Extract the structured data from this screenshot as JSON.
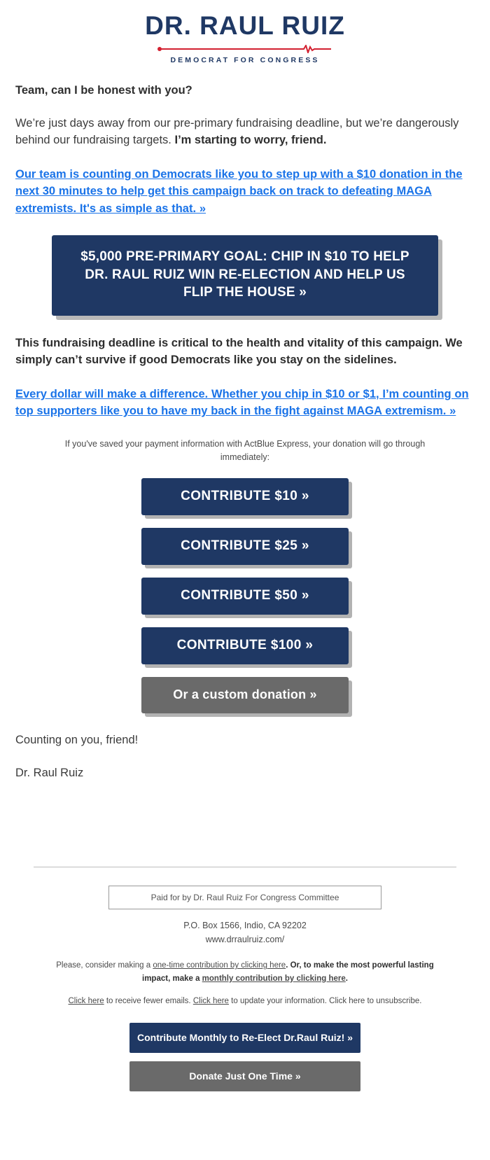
{
  "logo": {
    "name": "DR. RAUL RUIZ",
    "tagline": "DEMOCRAT FOR CONGRESS",
    "navy": "#1f3864",
    "red": "#d32030"
  },
  "body": {
    "lead_question": "Team, can I be honest with you?",
    "para1_plain": "We’re just days away from our pre-primary fundraising deadline, but we’re dangerously behind our fundraising targets. ",
    "para1_bold": "I’m starting to worry, friend.",
    "link1": "Our team is counting on Democrats like you to step up with a $10 donation in the next 30 minutes to help get this campaign back on track to defeating MAGA extremists. It's as simple as that. »",
    "banner": "$5,000 PRE-PRIMARY GOAL: CHIP IN $10 TO HELP DR. RAUL RUIZ WIN RE-ELECTION AND HELP US FLIP THE HOUSE »",
    "para2": "This fundraising deadline is critical to the health and vitality of this campaign. We simply can’t survive if good Democrats like you stay on the sidelines.",
    "link2": "Every dollar will make a difference. Whether you chip in $10 or $1, I’m counting on top supporters like you to have my back in the fight against MAGA extremism. »",
    "actblue_note": "If you've saved your payment information with ActBlue Express, your donation will go through immediately:",
    "signoff_line1": "Counting on you, friend!",
    "signoff_line2": "Dr. Raul Ruiz"
  },
  "donate_buttons": [
    {
      "label": "CONTRIBUTE $10 »",
      "style": "navy"
    },
    {
      "label": "CONTRIBUTE $25 »",
      "style": "navy"
    },
    {
      "label": "CONTRIBUTE $50 »",
      "style": "navy"
    },
    {
      "label": "CONTRIBUTE $100 »",
      "style": "navy"
    },
    {
      "label": "Or a custom donation »",
      "style": "gray"
    }
  ],
  "footer": {
    "paid_for": "Paid for by Dr. Raul Ruiz For Congress Committee",
    "address": "P.O. Box 1566, Indio, CA 92202",
    "website": "www.drraulruiz.com/",
    "fineprint_pre": "Please, consider making a ",
    "fineprint_link1": "one-time contribution by clicking here",
    "fineprint_mid": ". Or, to make the most powerful lasting impact, make a ",
    "fineprint_link2": "monthly contribution by clicking here",
    "fineprint_end": ".",
    "unsub_link1": "Click here",
    "unsub_text1": " to receive fewer emails. ",
    "unsub_link2": "Click here",
    "unsub_text2": " to update your information. Click here to unsubscribe.",
    "btn_monthly": "Contribute Monthly to Re-Elect Dr.Raul Ruiz! »",
    "btn_onetime": "Donate Just One Time »"
  }
}
